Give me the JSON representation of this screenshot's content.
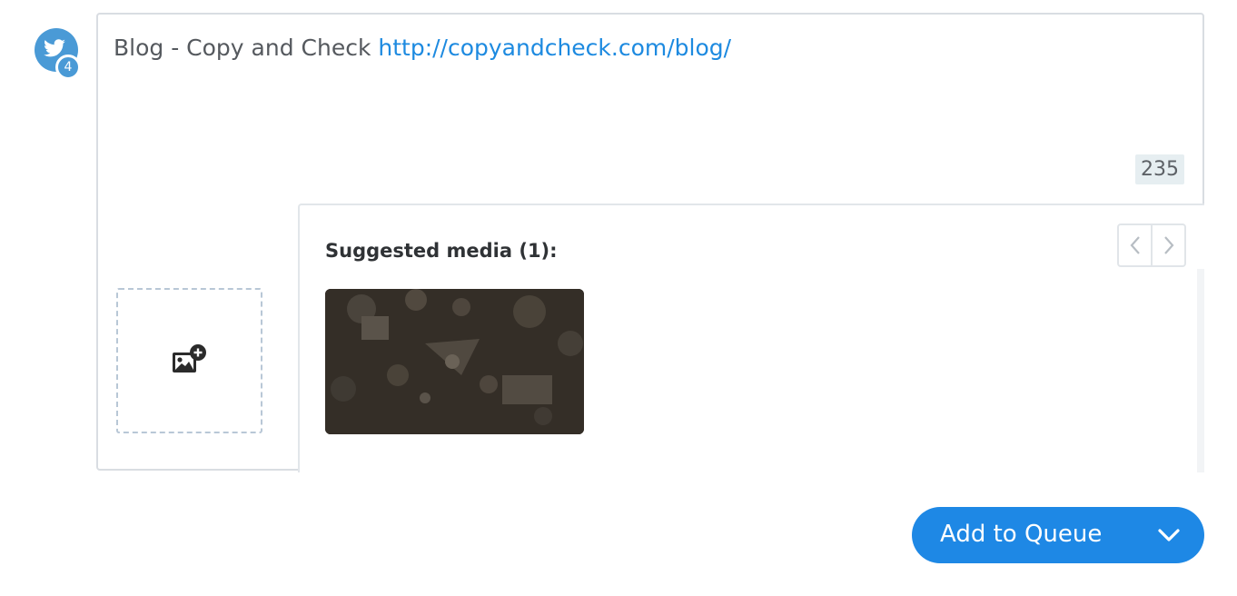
{
  "account": {
    "network_icon": "twitter-bird-icon",
    "badge_count": "4",
    "avatar_color": "#4a9ad6"
  },
  "composer": {
    "text": "Blog - Copy and Check ",
    "link": "http://copyandcheck.com/blog/",
    "char_count": "235",
    "text_color": "#55595e",
    "link_color": "#1d8ae0"
  },
  "media": {
    "add_icon": "add-image-icon",
    "suggested_title": "Suggested media (1):",
    "prev_icon": "chevron-left-icon",
    "next_icon": "chevron-right-icon"
  },
  "actions": {
    "queue_label": "Add to Queue",
    "queue_icon": "chevron-down-icon",
    "accent": "#1e88e5"
  }
}
